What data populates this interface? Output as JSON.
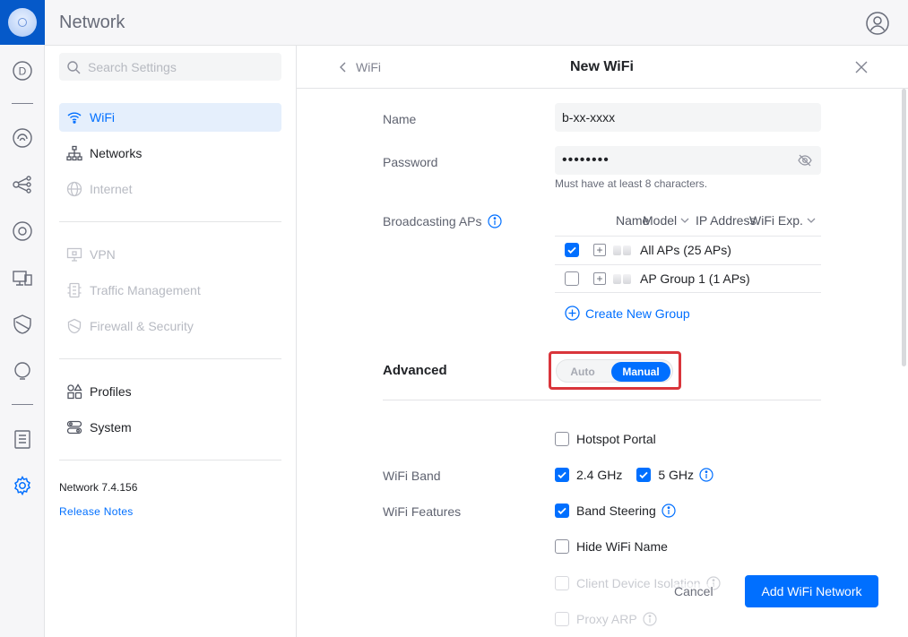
{
  "app": {
    "title": "Network"
  },
  "rail": {
    "items": [
      {
        "icon": "dashboard-d-icon"
      },
      {
        "icon": "topology-icon"
      },
      {
        "icon": "devices-icon"
      },
      {
        "icon": "clients-icon"
      },
      {
        "icon": "insights-icon"
      },
      {
        "icon": "security-shield-icon"
      },
      {
        "icon": "alerts-bulb-icon"
      },
      {
        "icon": "logs-clipboard-icon"
      },
      {
        "icon": "settings-gear-icon"
      }
    ],
    "dashboard_letter": "D"
  },
  "sidebar": {
    "search_placeholder": "Search Settings",
    "items": [
      {
        "label": "WiFi",
        "state": "active"
      },
      {
        "label": "Networks",
        "state": "normal"
      },
      {
        "label": "Internet",
        "state": "disabled"
      },
      {
        "label": "VPN",
        "state": "disabled"
      },
      {
        "label": "Traffic Management",
        "state": "disabled"
      },
      {
        "label": "Firewall & Security",
        "state": "disabled"
      },
      {
        "label": "Profiles",
        "state": "normal"
      },
      {
        "label": "System",
        "state": "normal"
      }
    ],
    "version": "Network 7.4.156",
    "release_notes": "Release Notes"
  },
  "panel": {
    "back_label": "WiFi",
    "title": "New WiFi",
    "name_label": "Name",
    "name_value": "b-xx-xxxx",
    "password_label": "Password",
    "password_value": "••••••••",
    "password_hint": "Must have at least 8 characters.",
    "broadcasting_label": "Broadcasting APs",
    "ap_columns": [
      "Name",
      "Model",
      "IP Address",
      "WiFi Exp."
    ],
    "ap_rows": [
      {
        "label": "All APs (25 APs)",
        "checked": true
      },
      {
        "label": "AP Group 1 (1 APs)",
        "checked": false
      }
    ],
    "create_group": "Create New Group",
    "advanced_label": "Advanced",
    "mode_auto": "Auto",
    "mode_manual": "Manual",
    "mode_selected": "Manual",
    "hotspot_portal": "Hotspot Portal",
    "wifi_band_label": "WiFi Band",
    "band_24": "2.4 GHz",
    "band_5": "5 GHz",
    "wifi_features_label": "WiFi Features",
    "band_steering": "Band Steering",
    "hide_wifi_name": "Hide WiFi Name",
    "client_isolation": "Client Device Isolation",
    "proxy_arp": "Proxy ARP",
    "cancel": "Cancel",
    "submit": "Add WiFi Network"
  },
  "colors": {
    "accent": "#006fff",
    "brand": "#0559c9",
    "highlight": "#d9353b"
  }
}
